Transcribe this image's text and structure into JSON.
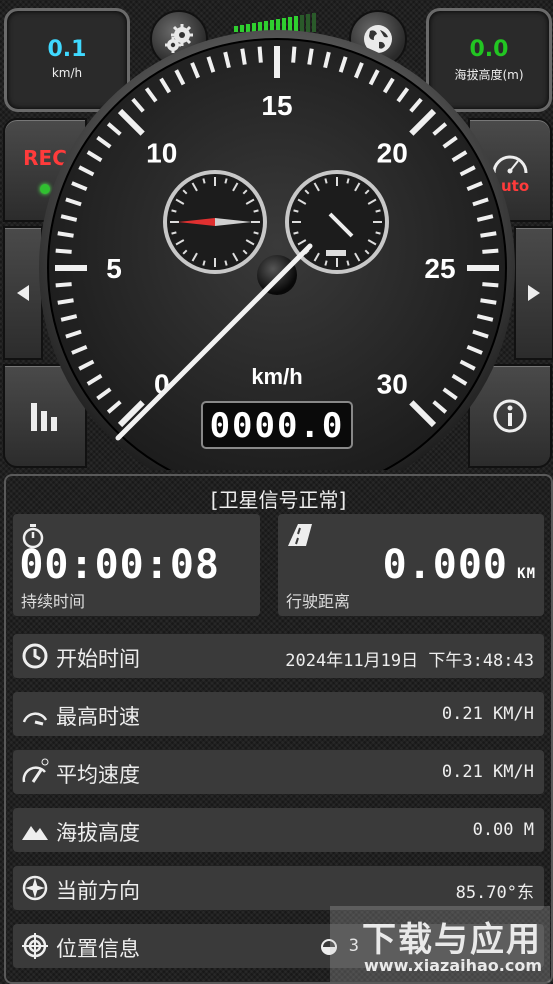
{
  "top": {
    "speed_value": "0.1",
    "speed_unit": "km/h",
    "altitude_value": "0.0",
    "altitude_label": "海拔高度(m)"
  },
  "left": {
    "rec_label": "REC"
  },
  "right": {
    "auto_label": "auto"
  },
  "gauge": {
    "ticks": [
      "0",
      "5",
      "10",
      "15",
      "20",
      "25",
      "30"
    ],
    "unit": "km/h",
    "odometer": "0000.0",
    "needle_value": 0
  },
  "status": "[卫星信号正常]",
  "duration": {
    "value": "00:00:08",
    "label": "持续时间"
  },
  "distance": {
    "value": "0.000",
    "unit": "KM",
    "label": "行驶距离"
  },
  "rows": [
    {
      "label": "开始时间",
      "value": "2024年11月19日 下午3:48:43",
      "icon": "clock-icon"
    },
    {
      "label": "最高时速",
      "value": "0.21 KM/H",
      "icon": "max-speed-icon"
    },
    {
      "label": "平均速度",
      "value": "0.21 KM/H",
      "icon": "avg-speed-icon"
    },
    {
      "label": "海拔高度",
      "value": "0.00 M",
      "icon": "mountain-icon"
    },
    {
      "label": "当前方向",
      "value": "85.70°东",
      "icon": "compass-icon"
    },
    {
      "label": "位置信息",
      "value": "3",
      "icon": "location-target-icon"
    }
  ],
  "watermark": {
    "title": "下载与应用",
    "url": "www.xiazaihao.com"
  },
  "colors": {
    "speed": "#3fd9ff",
    "altitude": "#22c522",
    "rec": "#ff3b3b",
    "led": "#30c030",
    "signal": "#2fcf2f"
  }
}
